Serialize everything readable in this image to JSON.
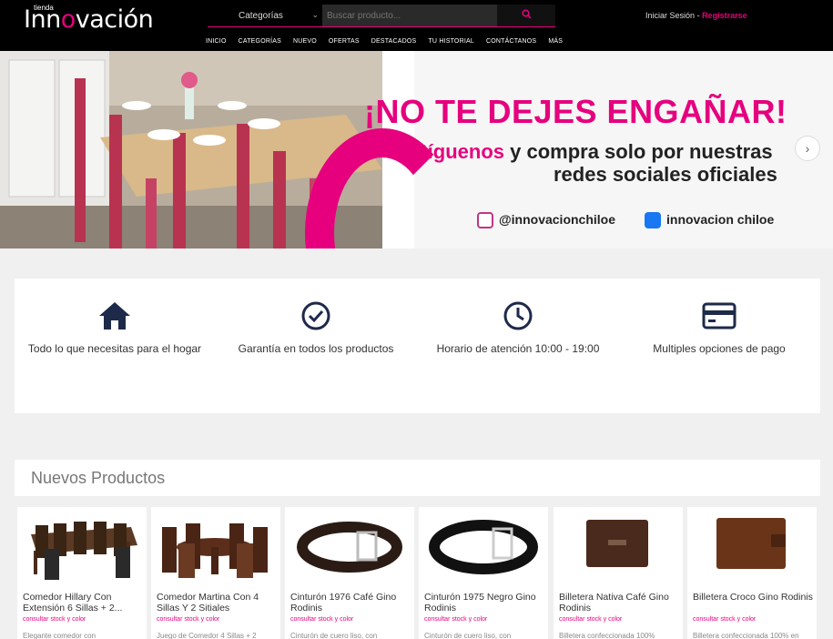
{
  "header": {
    "logo_small": "tienda",
    "logo_pre": "Inn",
    "logo_o": "o",
    "logo_post": "vación",
    "category_select": "Categorías",
    "search_placeholder": "Buscar producto...",
    "login": "Iniciar Sesión",
    "separator": "-",
    "register": "Registrarse"
  },
  "nav": [
    "INICIO",
    "CATEGORÍAS",
    "NUEVO",
    "OFERTAS",
    "DESTACADOS",
    "TU HISTORIAL",
    "CONTÁCTANOS",
    "MÁS"
  ],
  "banner": {
    "headline": "¡NO TE DEJES ENGAÑAR!",
    "sub_highlight": "Síguenos",
    "sub_rest": " y compra solo por nuestras",
    "sub_line2": "redes sociales oficiales",
    "instagram": "@innovacionchiloe",
    "facebook": "innovacion chiloe"
  },
  "features": [
    {
      "icon": "home-icon",
      "label": "Todo lo que necesitas para el hogar"
    },
    {
      "icon": "check-circle-icon",
      "label": "Garantía en todos los productos"
    },
    {
      "icon": "clock-icon",
      "label": "Horario de atención 10:00 - 19:00"
    },
    {
      "icon": "credit-card-icon",
      "label": "Multiples opciones de pago"
    }
  ],
  "new_products": {
    "title": "Nuevos Productos",
    "items": [
      {
        "name": "Comedor Hillary Con Extensión 6 Sillas + 2...",
        "stock": "consultar stock y color",
        "desc": "Elegante comedor con"
      },
      {
        "name": "Comedor Martina Con 4 Sillas Y 2 Sitiales",
        "stock": "consultar stock y color",
        "desc": "Juego de Comedor 4 Sillas + 2"
      },
      {
        "name": "Cinturón 1976 Café Gino Rodinis",
        "stock": "consultar stock y color",
        "desc": "Cinturón de cuero liso, con"
      },
      {
        "name": "Cinturón 1975 Negro Gino Rodinis",
        "stock": "consultar stock y color",
        "desc": "Cinturón de cuero liso, con"
      },
      {
        "name": "Billetera Nativa Café Gino Rodinis",
        "stock": "consultar stock y color",
        "desc": "Billetera  confeccionada 100%"
      },
      {
        "name": "Billetera Croco Gino Rodinis",
        "stock": "consultar stock y color",
        "desc": "Billetera confeccionada 100% en"
      }
    ]
  },
  "colors": {
    "accent": "#e6007e",
    "header_bg": "#000000",
    "icon_navy": "#1e2a4a"
  }
}
